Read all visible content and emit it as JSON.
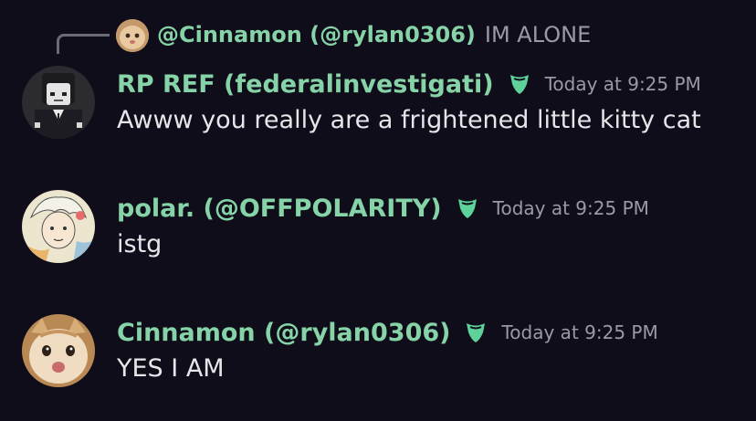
{
  "reply": {
    "author": "@Cinnamon (@rylan0306)",
    "text": "IM ALONE"
  },
  "messages": [
    {
      "author": "RP REF (federalinvestigati)",
      "timestamp": "Today at 9:25 PM",
      "content": "Awww you really are a frightened little kitty cat",
      "avatar_icon": "roblox-avatar-icon"
    },
    {
      "author": "polar. (@OFFPOLARITY)",
      "timestamp": "Today at 9:25 PM",
      "content": "istg",
      "avatar_icon": "anime-avatar-icon"
    },
    {
      "author": "Cinnamon (@rylan0306)",
      "timestamp": "Today at 9:25 PM",
      "content": "YES I AM",
      "avatar_icon": "cat-avatar-icon"
    }
  ],
  "colors": {
    "background": "#0f0d19",
    "author": "#86d3a8",
    "timestamp": "#9a9aa4",
    "text": "#e6e6ea"
  }
}
